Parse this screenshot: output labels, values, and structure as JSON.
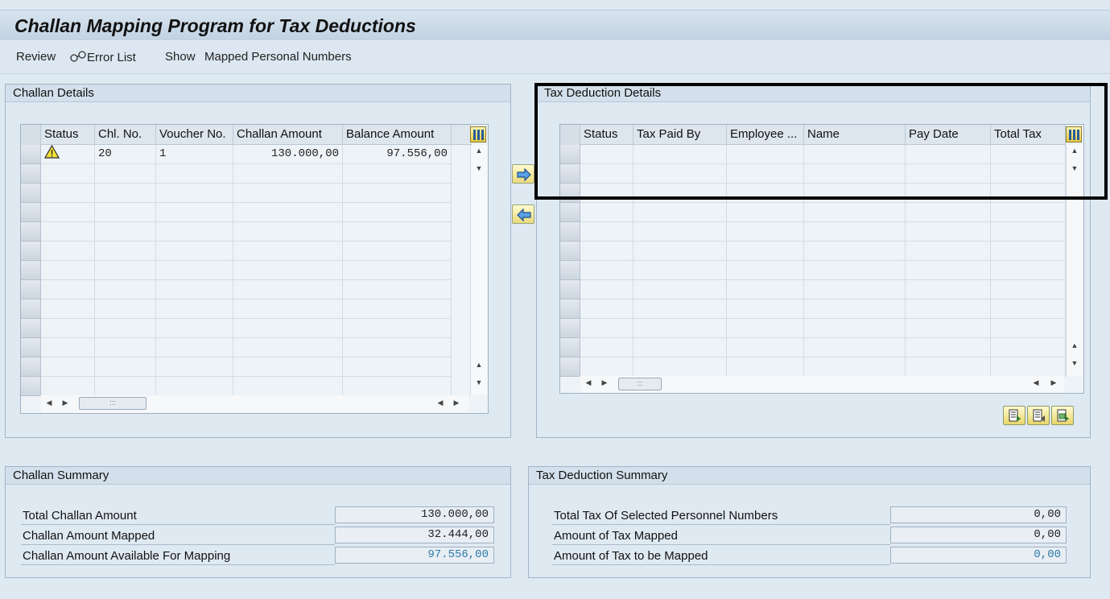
{
  "title": "Challan Mapping Program for Tax Deductions",
  "toolbar": {
    "review": "Review",
    "error_list": "Error List",
    "show": "Show",
    "mapped_personal_numbers": "Mapped Personal Numbers"
  },
  "challan_details": {
    "title": "Challan Details",
    "columns": [
      "Status",
      "Chl. No.",
      "Voucher No.",
      "Challan Amount",
      "Balance Amount"
    ],
    "rows": [
      {
        "status": "warning-icon",
        "chl_no": "20",
        "voucher_no": "1",
        "challan_amount": "130.000,00",
        "balance_amount": "97.556,00"
      }
    ]
  },
  "tax_deduction_details": {
    "title": "Tax Deduction Details",
    "columns": [
      "Status",
      "Tax Paid By",
      "Employee ...",
      "Name",
      "Pay Date",
      "Total Tax"
    ],
    "rows": []
  },
  "challan_summary": {
    "title": "Challan Summary",
    "total_challan_amount_label": "Total Challan Amount",
    "total_challan_amount": "130.000,00",
    "challan_amount_mapped_label": "Challan Amount Mapped",
    "challan_amount_mapped": "32.444,00",
    "challan_amount_available_label": "Challan Amount Available For Mapping",
    "challan_amount_available": "97.556,00"
  },
  "tax_deduction_summary": {
    "title": "Tax Deduction Summary",
    "total_tax_selected_label": "Total Tax Of Selected Personnel Numbers",
    "total_tax_selected": "0,00",
    "amount_tax_mapped_label": "Amount of Tax Mapped",
    "amount_tax_mapped": "0,00",
    "amount_tax_to_be_mapped_label": "Amount of Tax to be Mapped",
    "amount_tax_to_be_mapped": "0,00"
  },
  "colors": {
    "accent_blue": "#2e7aa8",
    "highlight": "#000000"
  }
}
